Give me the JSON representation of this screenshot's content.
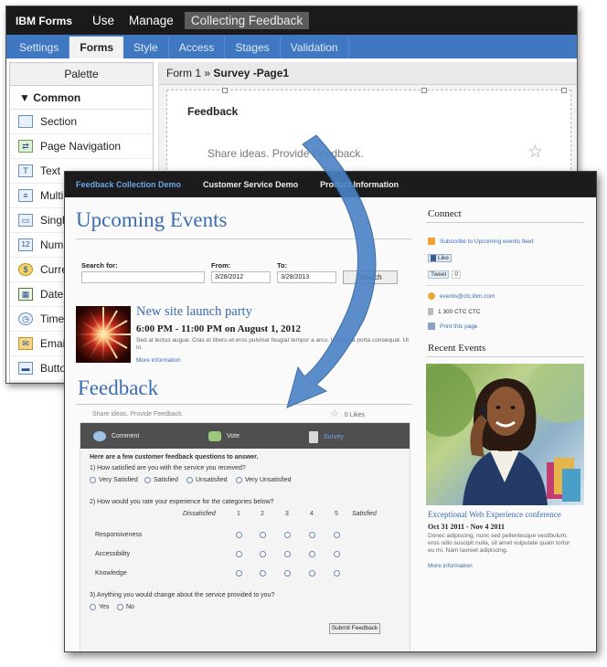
{
  "back_window": {
    "brand": "IBM Forms",
    "top_menu": [
      "Use",
      "Manage",
      "Collecting Feedback"
    ],
    "tabs": [
      "Settings",
      "Forms",
      "Style",
      "Access",
      "Stages",
      "Validation"
    ],
    "selected_tab": "Forms",
    "palette": {
      "title": "Palette",
      "category": "Common",
      "items": [
        {
          "label": "Section",
          "icon": "section-icon"
        },
        {
          "label": "Page Navigation",
          "icon": "page-navigation-icon"
        },
        {
          "label": "Text",
          "icon": "text-icon"
        },
        {
          "label": "Multi-L",
          "icon": "multiline-icon"
        },
        {
          "label": "Single",
          "icon": "single-select-icon"
        },
        {
          "label": "Numb",
          "icon": "number-icon"
        },
        {
          "label": "Curren",
          "icon": "currency-icon"
        },
        {
          "label": "Date",
          "icon": "date-icon"
        },
        {
          "label": "Time",
          "icon": "time-icon"
        },
        {
          "label": "Email",
          "icon": "email-icon"
        },
        {
          "label": "Button",
          "icon": "button-icon"
        }
      ]
    },
    "breadcrumb": {
      "form": "Form 1",
      "sep": "»",
      "page": "Survey -Page1"
    },
    "feedback_block": {
      "title": "Feedback",
      "placeholder": "Share ideas. Provide Feedback."
    }
  },
  "front_window": {
    "nav": [
      "Feedback Collection Demo",
      "Customer Service Demo",
      "Product Information"
    ],
    "nav_selected": "Feedback Collection Demo",
    "upcoming_title": "Upcoming Events",
    "search": {
      "search_for": "Search for:",
      "from_label": "From:",
      "from_value": "3/28/2012",
      "to_label": "To:",
      "to_value": "3/28/2013",
      "button": "Search"
    },
    "event": {
      "title": "New site launch party",
      "time": "6:00 PM - 11:00 PM on August 1, 2012",
      "desc": "Sed at lectus augue. Cras et libero et eros pulvinar feugiat tempor a arcu. Ut lacinia porta consequat. Ut in.",
      "more": "More information"
    },
    "feedback": {
      "title": "Feedback",
      "share": "Share ideas. Provide Feedback.",
      "likes": "0 Likes",
      "tabs": [
        "Comment",
        "Vote",
        "Survey"
      ],
      "selected_tab": "Survey",
      "intro": "Here are a few customer feedback questions to answer.",
      "q1": "1) How satisfied are you with the service you received?",
      "q1_options": [
        "Very Satisfied",
        "Satisfied",
        "Unsatisfied",
        "Very Unsatisfied"
      ],
      "q2": "2) How would you rate your experience for the categories below?",
      "scale_low": "Dissatisfied",
      "scale": [
        "1",
        "2",
        "3",
        "4",
        "5"
      ],
      "scale_high": "Satisfied",
      "rows": [
        "Responsiveness",
        "Accessibility",
        "Knowledge"
      ],
      "q3": "3) Anything you would change about the service provided to you?",
      "q3_options": [
        "Yes",
        "No"
      ],
      "submit": "Submit Feedback"
    },
    "sidebar": {
      "connect_title": "Connect",
      "subscribe": "Subscribe to Upcoming events feed",
      "like": "Like",
      "tweet": "Tweet",
      "tweet_count": "0",
      "email": "events@ctc.ibm.com",
      "phone": "1 300 CTC CTC",
      "print": "Print this page",
      "recent_title": "Recent Events",
      "event_title": "Exceptional Web Experience conference",
      "event_date": "Oct 31 2011 - Nov 4 2011",
      "event_desc": "Donec adipiscing, nunc sed pellentesque vestibulum, eros odio suscipit nulla, sit amet vulputate quam tortor eu mi. Nam laoreet adipiscing.",
      "event_more": "More information"
    }
  },
  "colors": {
    "ibm_tab_blue": "#3f78c0",
    "link_blue": "#3b6cb3",
    "arrow_blue": "#4b82c6",
    "dark_nav": "#1c1c1c"
  }
}
